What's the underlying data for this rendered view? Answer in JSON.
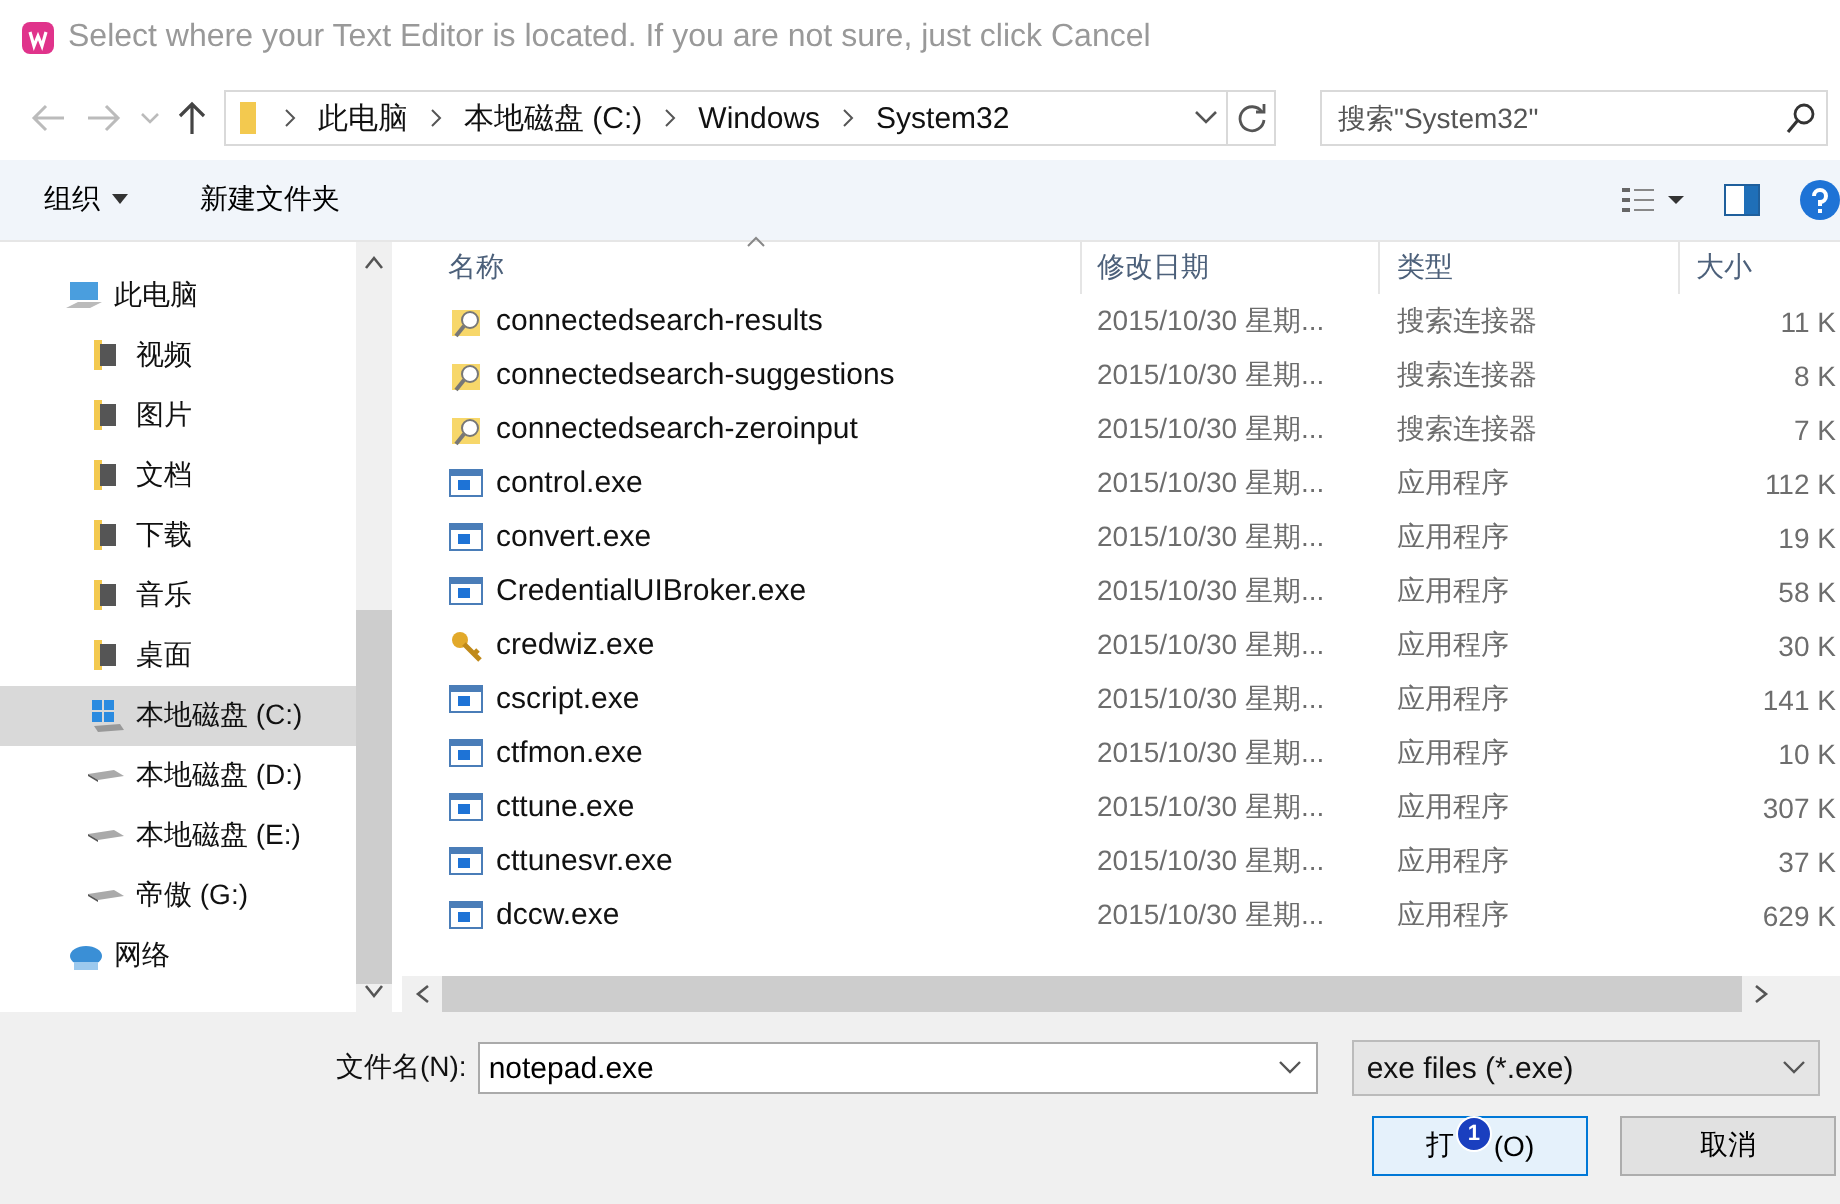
{
  "window": {
    "title": "Select where your Text Editor is located. If you are not sure, just click Cancel"
  },
  "address_bar": {
    "crumbs": [
      "此电脑",
      "本地磁盘 (C:)",
      "Windows",
      "System32"
    ]
  },
  "search": {
    "placeholder": "搜索\"System32\""
  },
  "toolbar": {
    "organize": "组织",
    "new_folder": "新建文件夹"
  },
  "sidebar": {
    "items": [
      {
        "label": "此电脑",
        "kind": "computer",
        "selected": false,
        "children": [
          {
            "label": "视频",
            "kind": "folder",
            "selected": false
          },
          {
            "label": "图片",
            "kind": "folder",
            "selected": false
          },
          {
            "label": "文档",
            "kind": "folder",
            "selected": false
          },
          {
            "label": "下载",
            "kind": "folder",
            "selected": false
          },
          {
            "label": "音乐",
            "kind": "folder",
            "selected": false
          },
          {
            "label": "桌面",
            "kind": "folder",
            "selected": false
          },
          {
            "label": "本地磁盘 (C:)",
            "kind": "system-drive",
            "selected": true
          },
          {
            "label": "本地磁盘 (D:)",
            "kind": "drive",
            "selected": false
          },
          {
            "label": "本地磁盘 (E:)",
            "kind": "drive",
            "selected": false
          },
          {
            "label": "帝傲 (G:)",
            "kind": "drive",
            "selected": false
          }
        ]
      },
      {
        "label": "网络",
        "kind": "network",
        "selected": false
      }
    ]
  },
  "table": {
    "columns": [
      "名称",
      "修改日期",
      "类型",
      "大小"
    ],
    "rows": [
      {
        "kind": "search-connector",
        "name": "connectedsearch-results",
        "date": "2015/10/30 星期...",
        "type": "搜索连接器",
        "size": "11 K"
      },
      {
        "kind": "search-connector",
        "name": "connectedsearch-suggestions",
        "date": "2015/10/30 星期...",
        "type": "搜索连接器",
        "size": "8 K"
      },
      {
        "kind": "search-connector",
        "name": "connectedsearch-zeroinput",
        "date": "2015/10/30 星期...",
        "type": "搜索连接器",
        "size": "7 K"
      },
      {
        "kind": "app",
        "name": "control.exe",
        "date": "2015/10/30 星期...",
        "type": "应用程序",
        "size": "112 K"
      },
      {
        "kind": "app",
        "name": "convert.exe",
        "date": "2015/10/30 星期...",
        "type": "应用程序",
        "size": "19 K"
      },
      {
        "kind": "app",
        "name": "CredentialUIBroker.exe",
        "date": "2015/10/30 星期...",
        "type": "应用程序",
        "size": "58 K"
      },
      {
        "kind": "key",
        "name": "credwiz.exe",
        "date": "2015/10/30 星期...",
        "type": "应用程序",
        "size": "30 K"
      },
      {
        "kind": "app",
        "name": "cscript.exe",
        "date": "2015/10/30 星期...",
        "type": "应用程序",
        "size": "141 K"
      },
      {
        "kind": "app",
        "name": "ctfmon.exe",
        "date": "2015/10/30 星期...",
        "type": "应用程序",
        "size": "10 K"
      },
      {
        "kind": "app",
        "name": "cttune.exe",
        "date": "2015/10/30 星期...",
        "type": "应用程序",
        "size": "307 K"
      },
      {
        "kind": "app",
        "name": "cttunesvr.exe",
        "date": "2015/10/30 星期...",
        "type": "应用程序",
        "size": "37 K"
      },
      {
        "kind": "app",
        "name": "dccw.exe",
        "date": "2015/10/30 星期...",
        "type": "应用程序",
        "size": "629 K"
      }
    ]
  },
  "filename": {
    "label": "文件名(N):",
    "value": "notepad.exe"
  },
  "filter": {
    "value": "exe files (*.exe)"
  },
  "buttons": [
    {
      "label_parts": [
        "打",
        "(O)"
      ],
      "kind": "primary",
      "badge": "1"
    },
    {
      "label": "取消",
      "kind": "normal"
    }
  ]
}
